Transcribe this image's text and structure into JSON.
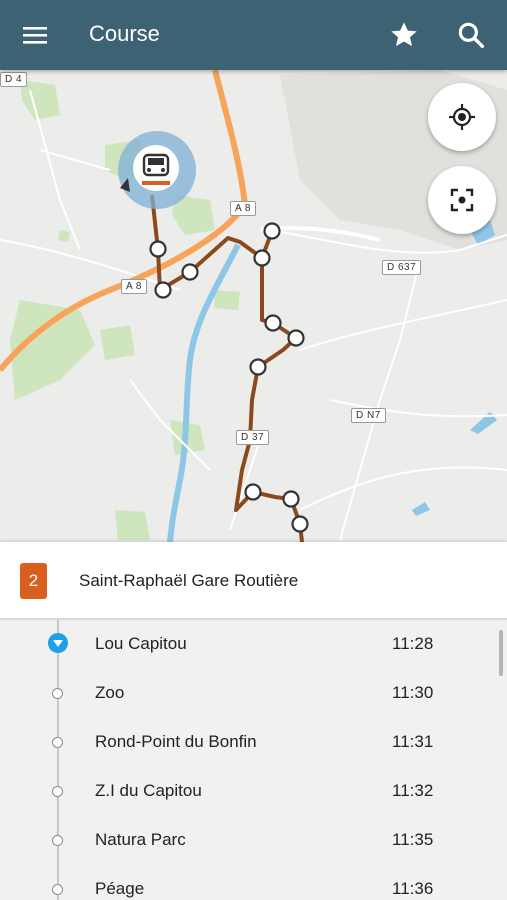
{
  "app_bar": {
    "title": "Course",
    "icons": [
      "menu-icon",
      "star-icon",
      "search-icon"
    ],
    "color": "#3c6273"
  },
  "map": {
    "road_labels": [
      "D 4",
      "A 8",
      "A 8",
      "D 637",
      "D N7",
      "D 37"
    ],
    "buttons": [
      "my-location-icon",
      "center-focus-icon"
    ],
    "route_color": "#8b4a1e",
    "vehicle_icon": "bus-icon"
  },
  "route": {
    "number": "2",
    "name": "Saint-Raphaël Gare Routière",
    "badge_color": "#d85f1e"
  },
  "stops": [
    {
      "name": "Lou Capitou",
      "time": "11:28",
      "current": true
    },
    {
      "name": "Zoo",
      "time": "11:30",
      "current": false
    },
    {
      "name": "Rond-Point du Bonfin",
      "time": "11:31",
      "current": false
    },
    {
      "name": "Z.I du Capitou",
      "time": "11:32",
      "current": false
    },
    {
      "name": "Natura Parc",
      "time": "11:35",
      "current": false
    },
    {
      "name": "Péage",
      "time": "11:36",
      "current": false
    }
  ]
}
